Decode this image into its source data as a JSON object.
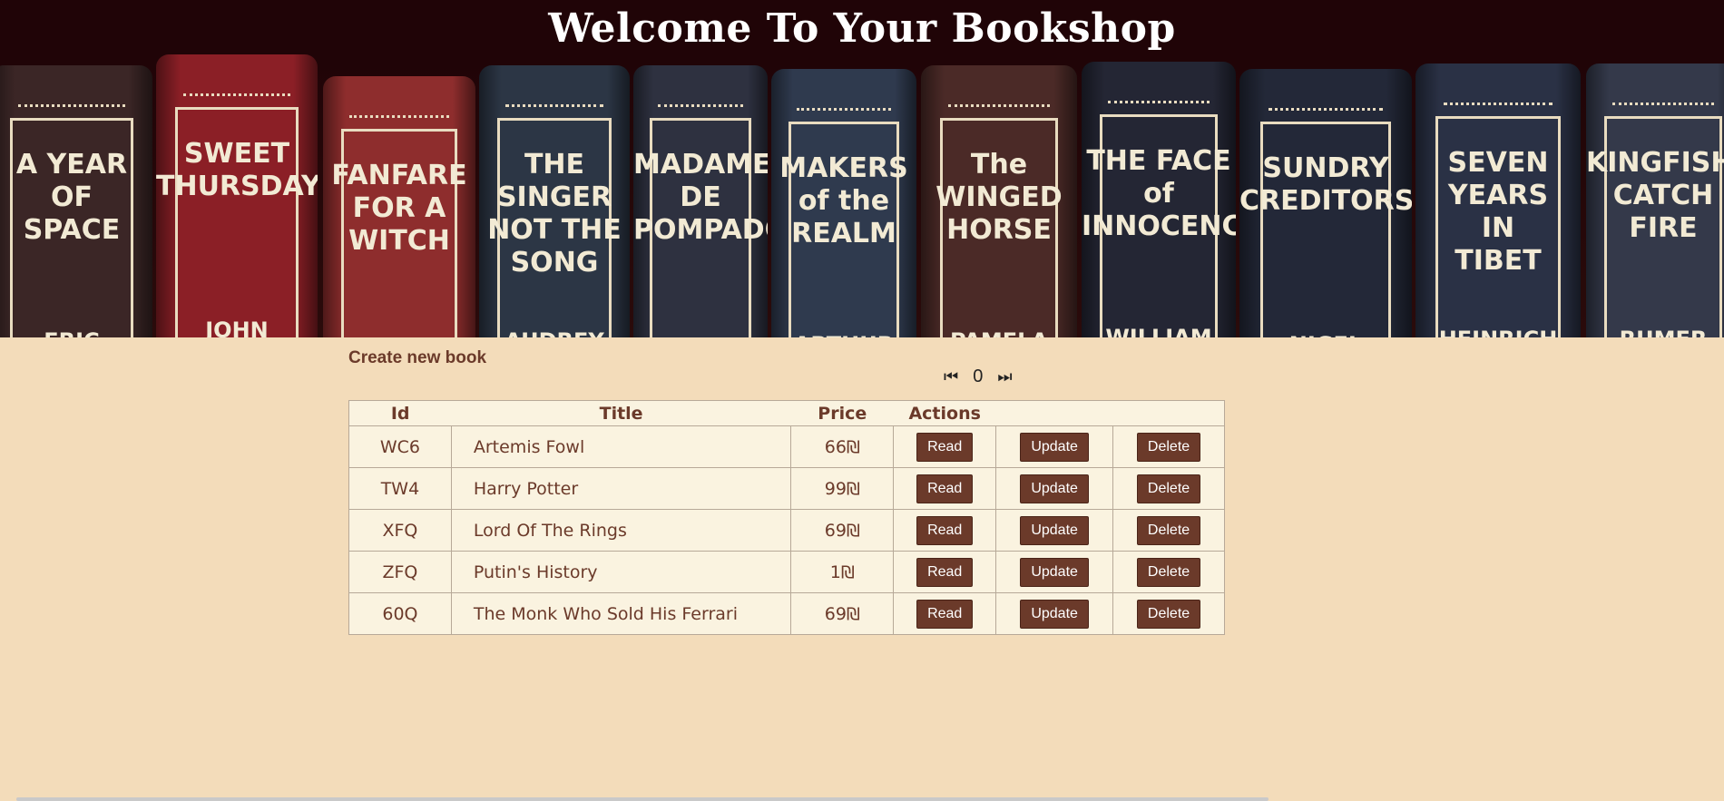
{
  "header": {
    "title": "Welcome To Your Bookshop",
    "banner_books": [
      {
        "title": "A YEAR\nOF\nSPACE",
        "author": "ERIC",
        "color": "#3b2626"
      },
      {
        "title": "SWEET\nTHURSDAY",
        "author": "JOHN",
        "color": "#8b1f26"
      },
      {
        "title": "FANFARE\nFOR A\nWITCH",
        "author": "",
        "color": "#8e2d2d"
      },
      {
        "title": "THE\nSINGER\nNOT THE\nSONG",
        "author": "AUDREY",
        "color": "#2c3645"
      },
      {
        "title": "MADAME\nDE\nPOMPADOUR",
        "author": "",
        "color": "#2e3140"
      },
      {
        "title": "MAKERS\nof the\nREALM",
        "author": "ARTHUR",
        "color": "#2f3a4e"
      },
      {
        "title": "The\nWINGED\nHORSE",
        "author": "PAMELA",
        "color": "#4b2a27"
      },
      {
        "title": "THE FACE\nof\nINNOCENCE",
        "author": "WILLIAM",
        "color": "#242634"
      },
      {
        "title": "SUNDRY\nCREDITORS",
        "author": "NIGEL",
        "color": "#232838"
      },
      {
        "title": "SEVEN\nYEARS\nIN\nTIBET",
        "author": "HEINRICH",
        "color": "#2a3145"
      },
      {
        "title": "KINGFISHERS\nCATCH FIRE",
        "author": "RUMER",
        "color": "#34394a"
      }
    ]
  },
  "create_link": "Create new book",
  "pager": {
    "first_icon": "skip-first-icon",
    "page": "0",
    "last_icon": "skip-last-icon"
  },
  "table": {
    "headers": {
      "id": "Id",
      "title": "Title",
      "price": "Price",
      "actions": "Actions"
    },
    "rows": [
      {
        "id": "WC6",
        "title": "Artemis Fowl",
        "price": "66₪",
        "read": "Read",
        "update": "Update",
        "delete": "Delete"
      },
      {
        "id": "TW4",
        "title": "Harry Potter",
        "price": "99₪",
        "read": "Read",
        "update": "Update",
        "delete": "Delete"
      },
      {
        "id": "XFQ",
        "title": "Lord Of The Rings",
        "price": "69₪",
        "read": "Read",
        "update": "Update",
        "delete": "Delete"
      },
      {
        "id": "ZFQ",
        "title": "Putin's History",
        "price": "1₪",
        "read": "Read",
        "update": "Update",
        "delete": "Delete"
      },
      {
        "id": "60Q",
        "title": "The Monk Who Sold His Ferrari",
        "price": "69₪",
        "read": "Read",
        "update": "Update",
        "delete": "Delete"
      }
    ]
  },
  "colors": {
    "page_background": "#f3dcba",
    "table_background": "#faf3e0",
    "accent_brown": "#6b3a2a"
  }
}
